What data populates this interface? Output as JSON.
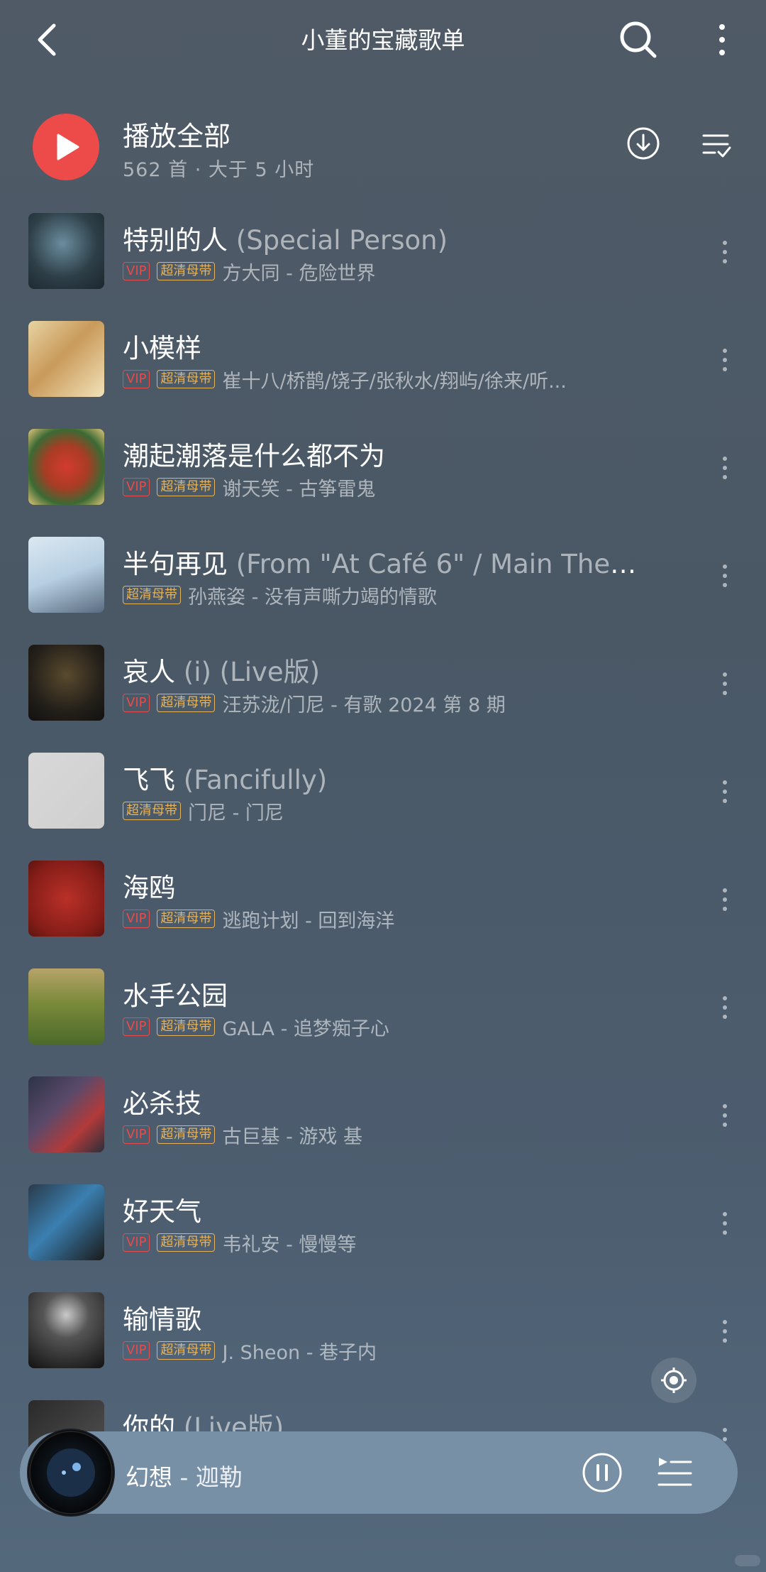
{
  "header": {
    "title": "小董的宝藏歌单"
  },
  "play_all": {
    "label": "播放全部",
    "subtitle": "562 首 · 大于 5 小时"
  },
  "badges": {
    "vip": "VIP",
    "hq": "超清母带"
  },
  "colors": {
    "accent_red": "#ed4a4a",
    "vip": "#e74c4c",
    "hq_gold": "#e6b35a"
  },
  "songs": [
    {
      "title": "特别的人",
      "subtitle": " (Special Person)",
      "vip": true,
      "hq": true,
      "artist": "方大同 - 危险世界"
    },
    {
      "title": "小模样",
      "subtitle": "",
      "vip": true,
      "hq": true,
      "artist": "崔十八/桥鹊/饶子/张秋水/翔屿/徐来/听..."
    },
    {
      "title": "潮起潮落是什么都不为",
      "subtitle": "",
      "vip": true,
      "hq": true,
      "artist": "谢天笑 - 古筝雷鬼"
    },
    {
      "title": "半句再见",
      "subtitle": " (From \"At Café 6\" / Main Theme...",
      "vip": false,
      "hq": true,
      "artist": "孙燕姿 - 没有声嘶力竭的情歌"
    },
    {
      "title": "哀人",
      "subtitle": " (i) (Live版)",
      "vip": true,
      "hq": true,
      "artist": "汪苏泷/门尼 - 有歌 2024 第 8 期"
    },
    {
      "title": "飞飞",
      "subtitle": " (Fancifully)",
      "vip": false,
      "hq": true,
      "artist": "门尼 - 门尼"
    },
    {
      "title": "海鸥",
      "subtitle": "",
      "vip": true,
      "hq": true,
      "artist": "逃跑计划 - 回到海洋"
    },
    {
      "title": "水手公园",
      "subtitle": "",
      "vip": true,
      "hq": true,
      "artist": "GALA - 追梦痴子心"
    },
    {
      "title": "必杀技",
      "subtitle": "",
      "vip": true,
      "hq": true,
      "artist": "古巨基 - 游戏 基"
    },
    {
      "title": "好天气",
      "subtitle": "",
      "vip": true,
      "hq": true,
      "artist": "韦礼安 - 慢慢等"
    },
    {
      "title": "输情歌",
      "subtitle": "",
      "vip": true,
      "hq": true,
      "artist": "J. Sheon - 巷子内"
    },
    {
      "title": "你的",
      "subtitle": " (Live版)",
      "vip": false,
      "hq": false,
      "artist": ""
    }
  ],
  "mini_player": {
    "song": "幻想",
    "separator": " - ",
    "artist": "迦勒"
  }
}
